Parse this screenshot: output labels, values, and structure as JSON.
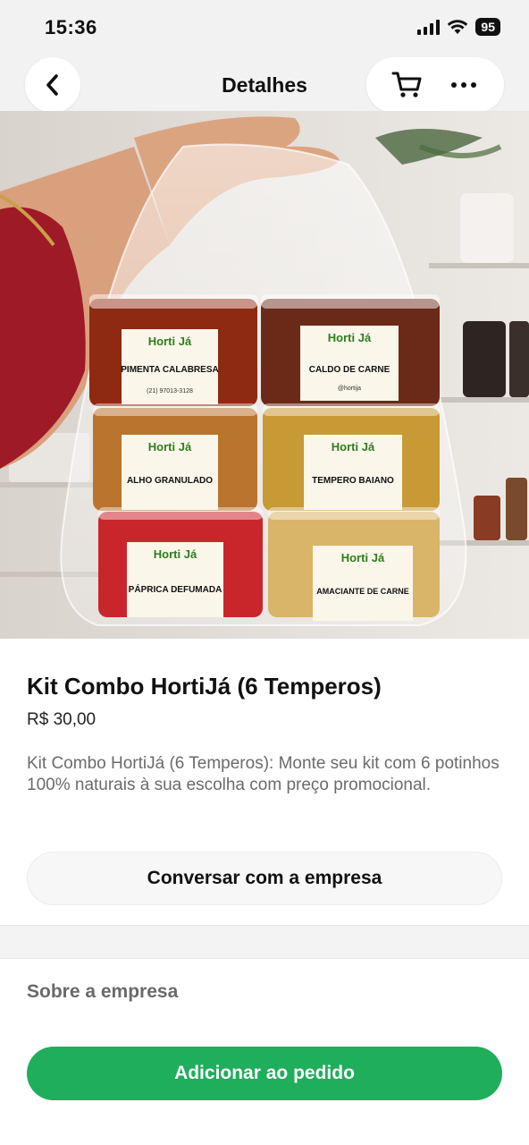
{
  "status_bar": {
    "time": "15:36",
    "battery": "95"
  },
  "nav": {
    "title": "Detalhes",
    "back_icon": "chevron-left-icon",
    "cart_icon": "cart-icon",
    "more_icon": "more-horizontal-icon"
  },
  "product_image": {
    "jars": [
      {
        "label": "PIMENTA CALABRESA",
        "color": "#8e2a12"
      },
      {
        "label": "CALDO DE CARNE",
        "color": "#6b2a18"
      },
      {
        "label": "ALHO GRANULADO",
        "color": "#b9742e"
      },
      {
        "label": "TEMPERO BAIANO",
        "color": "#c79a35"
      },
      {
        "label": "PÁPRICA DEFUMADA",
        "color": "#c9262b"
      },
      {
        "label": "AMACIANTE DE CARNE",
        "color": "#d9b56a"
      }
    ],
    "brand_logo": "HortiJá",
    "phone": "(21) 97013-3128",
    "instagram": "@hortija"
  },
  "product": {
    "title": "Kit Combo HortiJá (6 Temperos)",
    "price": "R$ 30,00",
    "description": "Kit Combo HortiJá (6 Temperos): Monte seu kit com 6 potinhos 100% naturais à sua escolha com preço promocional."
  },
  "buttons": {
    "chat": "Conversar com a empresa",
    "add": "Adicionar ao pedido"
  },
  "about": {
    "title": "Sobre a empresa"
  },
  "colors": {
    "primary_green": "#1fae5b"
  }
}
